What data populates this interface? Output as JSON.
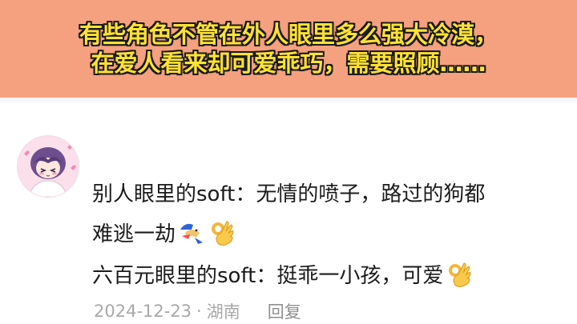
{
  "banner": {
    "line1": "有些角色不管在外人眼里多么强大冷漠，",
    "line2": "在爱人看来却可爱乖巧，需要照顾……",
    "bg_color": "#f5a07e",
    "text_color": "#ffe234"
  },
  "comment": {
    "avatar_icon": "anime-character-avatar",
    "line1": "别人眼里的soft：无情的喷子，路过的狗都",
    "line2": "难逃一劫",
    "line2_emojis": [
      "cheems-running-emoji",
      "ok-hand-emoji"
    ],
    "line3": "六百元眼里的soft：挺乖一小孩，可爱",
    "line3_emojis": [
      "ok-hand-emoji"
    ],
    "date": "2024-12-23",
    "separator": "·",
    "location": "湖南",
    "reply_label": "回复"
  }
}
